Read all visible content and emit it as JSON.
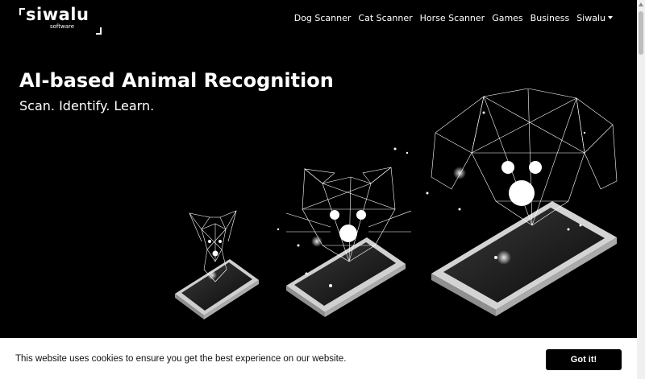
{
  "logo": {
    "word": "siwalu",
    "sub": "software"
  },
  "nav": {
    "items": [
      {
        "label": "Dog Scanner"
      },
      {
        "label": "Cat Scanner"
      },
      {
        "label": "Horse Scanner"
      },
      {
        "label": "Games"
      },
      {
        "label": "Business"
      },
      {
        "label": "Siwalu",
        "dropdown": true
      }
    ]
  },
  "hero": {
    "title": "AI-based Animal Recognition",
    "subtitle": "Scan. Identify. Learn."
  },
  "cookie": {
    "message": "This website uses cookies to ensure you get the best experience on our website.",
    "button": "Got it!"
  },
  "colors": {
    "background": "#000000",
    "text": "#ffffff",
    "cookie_bg": "#ffffff",
    "button_bg": "#000000"
  }
}
